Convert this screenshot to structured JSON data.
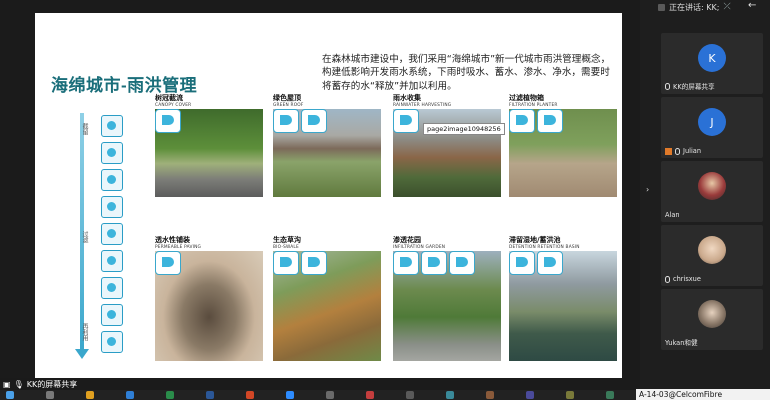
{
  "speaking": {
    "label": "正在讲话: KK;"
  },
  "slide": {
    "title": "海绵城市-雨洪管理",
    "intro": "在森林城市建设中，我们采用“海绵城市”新一代城市雨洪管理概念，构建低影响开发雨水系统，下雨时吸水、蓄水、渗水、净水，需要时将蓄存的水“释放”并加以利用。",
    "tooltip": "page2image10948256",
    "timeline": {
      "top_label": "截留",
      "mid_label": "过滤",
      "bottom_label": "再利用"
    },
    "tiles": [
      {
        "cn": "树冠截流",
        "en": "CANOPY COVER"
      },
      {
        "cn": "绿色屋顶",
        "en": "GREEN ROOF"
      },
      {
        "cn": "雨水收集",
        "en": "RAINWATER HARVESTING"
      },
      {
        "cn": "过滤植物箱",
        "en": "FILTRATION PLANTER"
      },
      {
        "cn": "透水性铺装",
        "en": "PERMEABLE PAVING"
      },
      {
        "cn": "生态草沟",
        "en": "BIO-SWALE"
      },
      {
        "cn": "渗透花园",
        "en": "INFILTRATION GARDEN"
      },
      {
        "cn": "滞留湿地/蓄洪池",
        "en": "DETENTION RETENTION BASIN"
      }
    ]
  },
  "participants": [
    {
      "initial": "K",
      "name": "KK的屏幕共享",
      "avatar_color": "#2a71d6"
    },
    {
      "initial": "J",
      "name": "Julian",
      "avatar_color": "#2a71d6"
    },
    {
      "initial": "",
      "name": "Alan",
      "avatar_color": "#7a3b3b"
    },
    {
      "initial": "",
      "name": "chrisxue",
      "avatar_color": "#d8c0a8"
    },
    {
      "initial": "",
      "name": "Yukan和健",
      "avatar_color": "#8a7a6a"
    }
  ],
  "share_badge": "KK的屏幕共享",
  "network": "A-14-03@CelcomFibre",
  "colors": {
    "accent": "#1a6e7a",
    "blue": "#2a71d6"
  }
}
